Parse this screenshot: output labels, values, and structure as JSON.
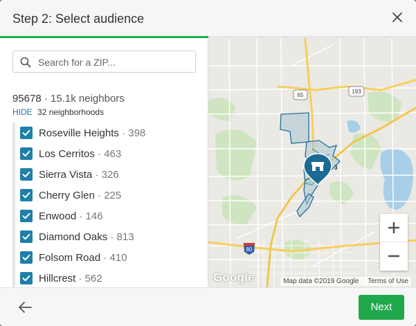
{
  "header": {
    "title": "Step 2: Select audience",
    "close_icon": "close-icon"
  },
  "progress": {
    "fraction": 0.5,
    "color": "#1cb04d"
  },
  "search": {
    "placeholder": "Search for a ZIP...",
    "value": ""
  },
  "zip": {
    "code": "95678",
    "neighbors": "· 15.1k neighbors"
  },
  "hide": {
    "link": "HIDE",
    "text": "32 neighborhoods"
  },
  "neighborhoods": [
    {
      "name": "Roseville Heights",
      "count": "· 398",
      "checked": true
    },
    {
      "name": "Los Cerritos",
      "count": "· 463",
      "checked": true
    },
    {
      "name": "Sierra Vista",
      "count": "· 326",
      "checked": true
    },
    {
      "name": "Cherry Glen",
      "count": "· 225",
      "checked": true
    },
    {
      "name": "Enwood",
      "count": "· 146",
      "checked": true
    },
    {
      "name": "Diamond Oaks",
      "count": "· 813",
      "checked": true
    },
    {
      "name": "Folsom Road",
      "count": "· 410",
      "checked": true
    },
    {
      "name": "Hillcrest",
      "count": "· 562",
      "checked": true
    }
  ],
  "map": {
    "route_labels": [
      "65",
      "193",
      "80",
      "3"
    ],
    "google": "Google",
    "map_data": "Map data ©2019 Google",
    "terms": "Terms of Use",
    "pin_icon": "store-icon"
  },
  "footer": {
    "back_icon": "arrow-left-icon",
    "next_label": "Next",
    "next_color": "#20a94b"
  },
  "colors": {
    "accent": "#1f7fa8",
    "link": "#1a73a8"
  }
}
